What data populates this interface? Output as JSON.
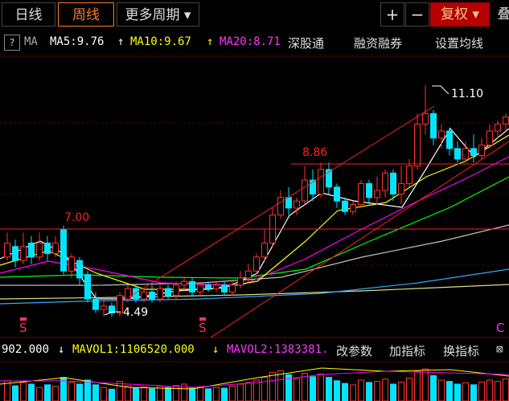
{
  "tabs": [
    {
      "label": "日线"
    },
    {
      "label": "周线"
    },
    {
      "label": "更多周期 ▾"
    }
  ],
  "toolbar": {
    "plus": "+",
    "minus": "−",
    "fuquan": "复权 ▾",
    "extra": "叠"
  },
  "ma_bar": {
    "help": "?",
    "label": "MA",
    "ma5": "MA5:9.76",
    "ma10": "MA10:9.67",
    "ma20": "MA20:8.71",
    "connect": "深股通",
    "margin": "融资融券",
    "settings": "设置均线",
    "arrow5": "↑",
    "arrow10": "↑"
  },
  "vol_bar": {
    "vol": "902.000",
    "arrow_vol": "↓",
    "mavol1": "MAVOL1:1106520.000",
    "arrow1": "↓",
    "mavol2": "MAVOL2:1383381.",
    "params": "改参数",
    "add": "加指标",
    "swap": "换指标",
    "x": "⊠"
  },
  "chart_labels": {
    "high": "11.10",
    "low": "4.49",
    "level1": "8.86",
    "level2": "7.00",
    "s1": "S",
    "s2": "S",
    "c": "C"
  },
  "colors": {
    "up": "#ff3333",
    "down": "#00e5ff",
    "ma5": "#ffffff",
    "ma10": "#ffff00",
    "ma20": "#ff00ff",
    "ma30": "#00ff00",
    "ma60": "#c0c0c0",
    "ma120": "#33aaff",
    "ma250": "#dddd88",
    "level": "#ff2020"
  }
}
